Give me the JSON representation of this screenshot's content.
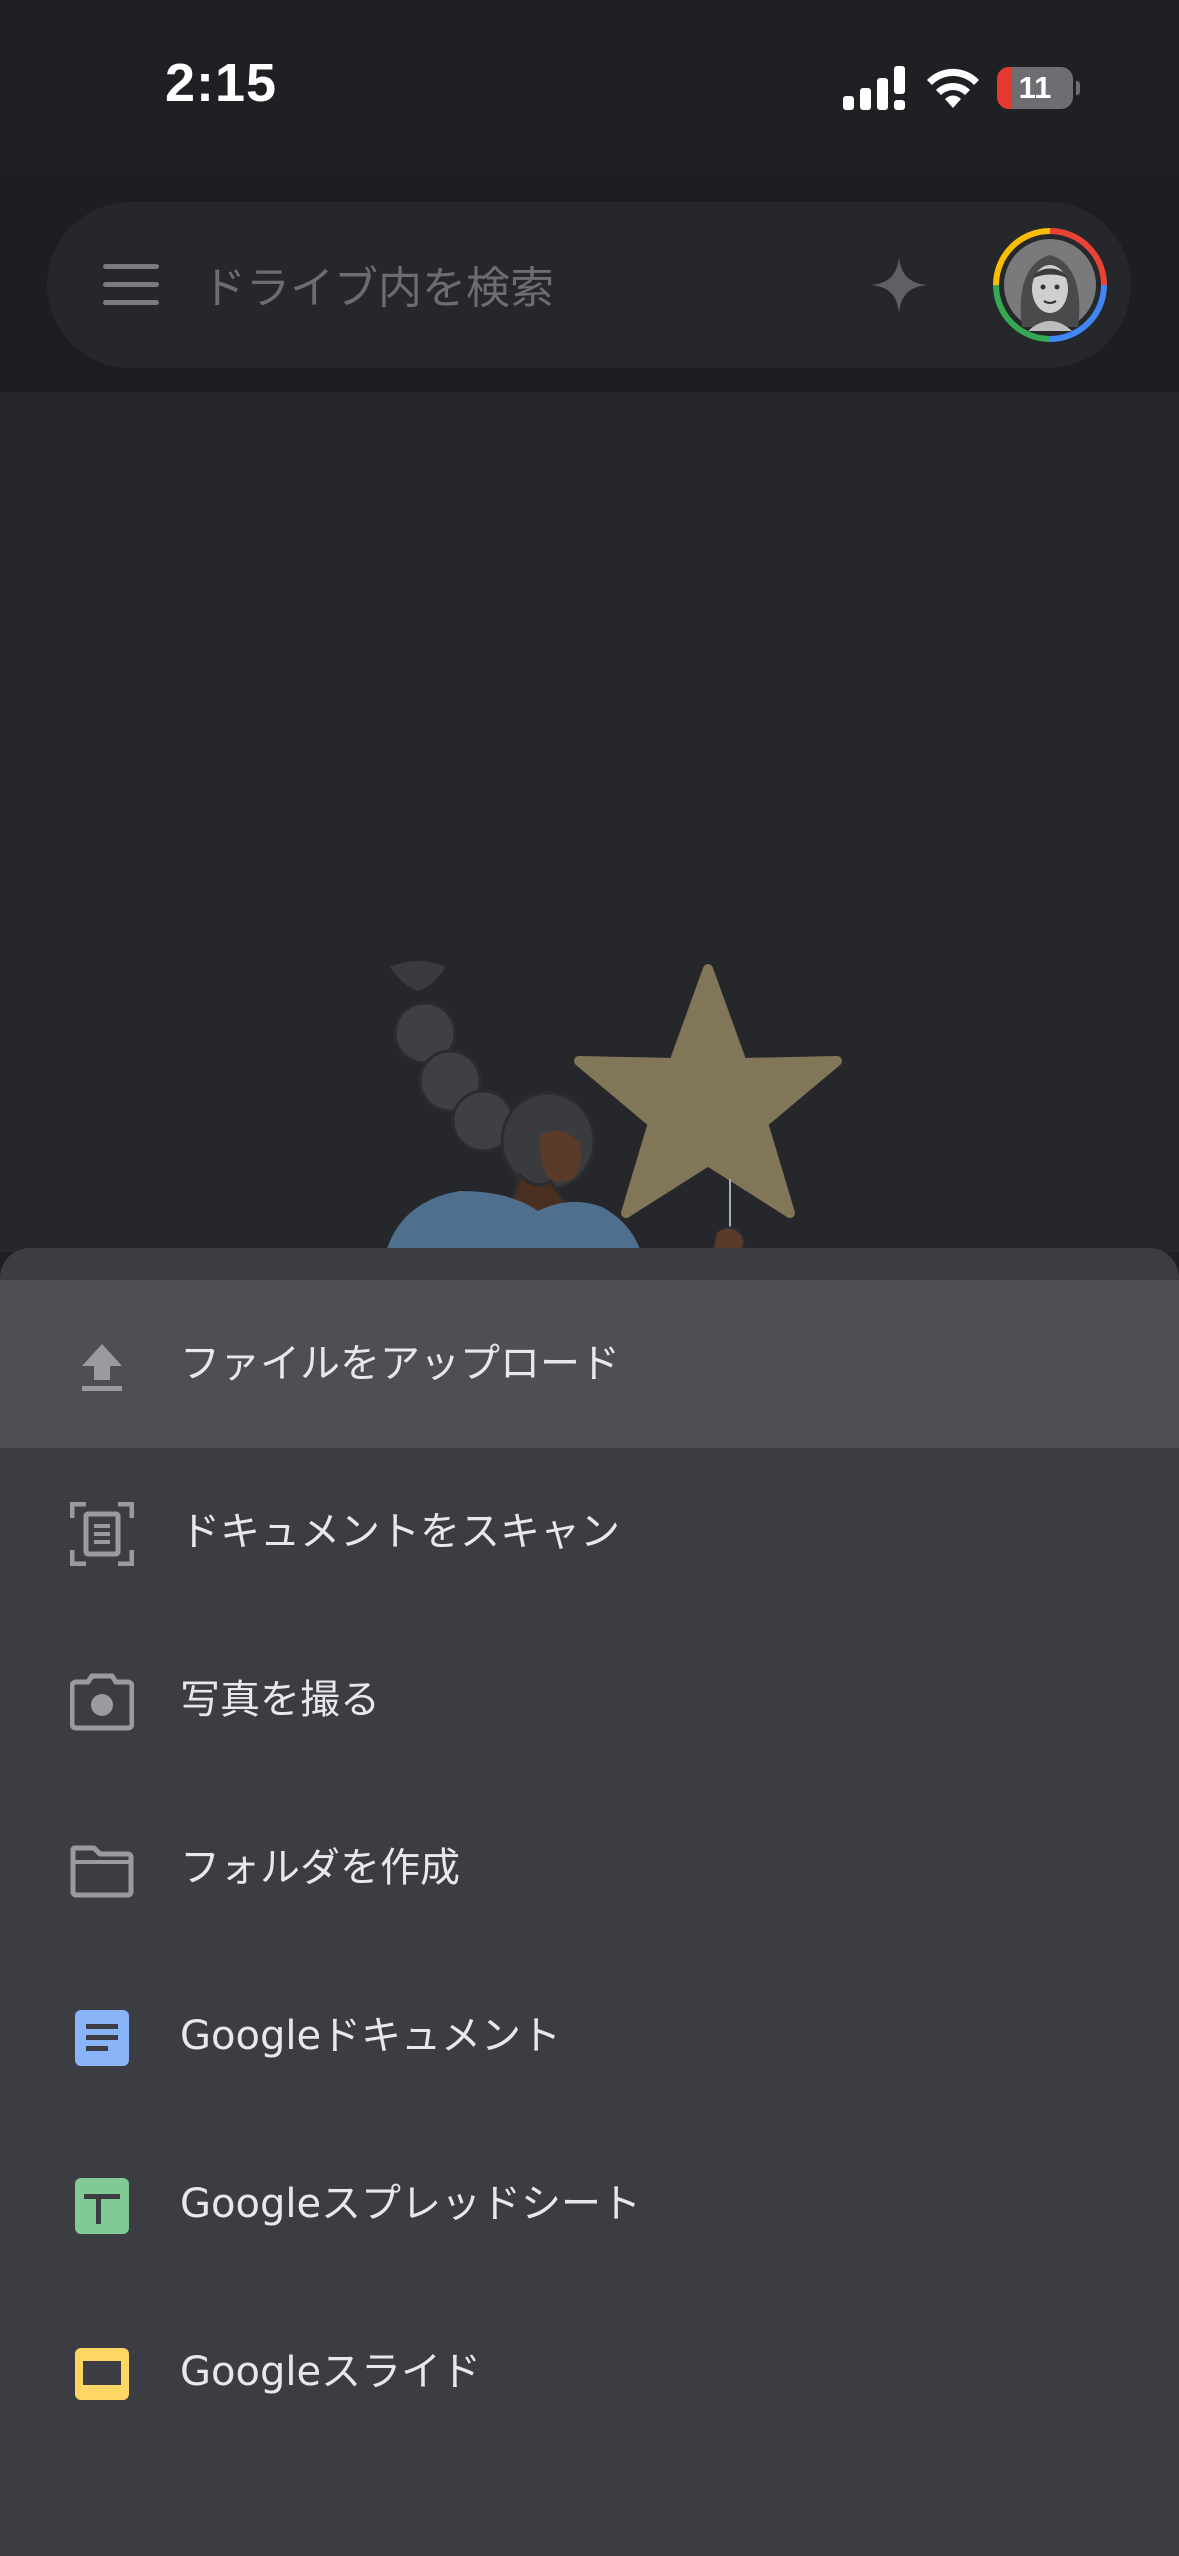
{
  "status_bar": {
    "time": "2:15",
    "battery_level": "11",
    "icons": [
      "cellular-signal-icon",
      "wifi-icon",
      "battery-icon"
    ]
  },
  "search": {
    "placeholder": "ドライブ内を検索",
    "icons": [
      "hamburger-menu-icon",
      "gemini-sparkle-icon",
      "account-avatar"
    ]
  },
  "menu": {
    "items": [
      {
        "label": "ファイルをアップロード",
        "icon": "upload-icon",
        "highlighted": true
      },
      {
        "label": "ドキュメントをスキャン",
        "icon": "scan-document-icon"
      },
      {
        "label": "写真を撮る",
        "icon": "camera-icon"
      },
      {
        "label": "フォルダを作成",
        "icon": "folder-icon"
      },
      {
        "label": "Googleドキュメント",
        "icon": "google-docs-icon"
      },
      {
        "label": "Googleスプレッドシート",
        "icon": "google-sheets-icon"
      },
      {
        "label": "Googleスライド",
        "icon": "google-slides-icon"
      }
    ]
  },
  "colors": {
    "docs": "#8ab4f8",
    "sheets": "#81c995",
    "slides": "#fdd663",
    "star": "#827659",
    "battery_low": "#e5392f"
  }
}
